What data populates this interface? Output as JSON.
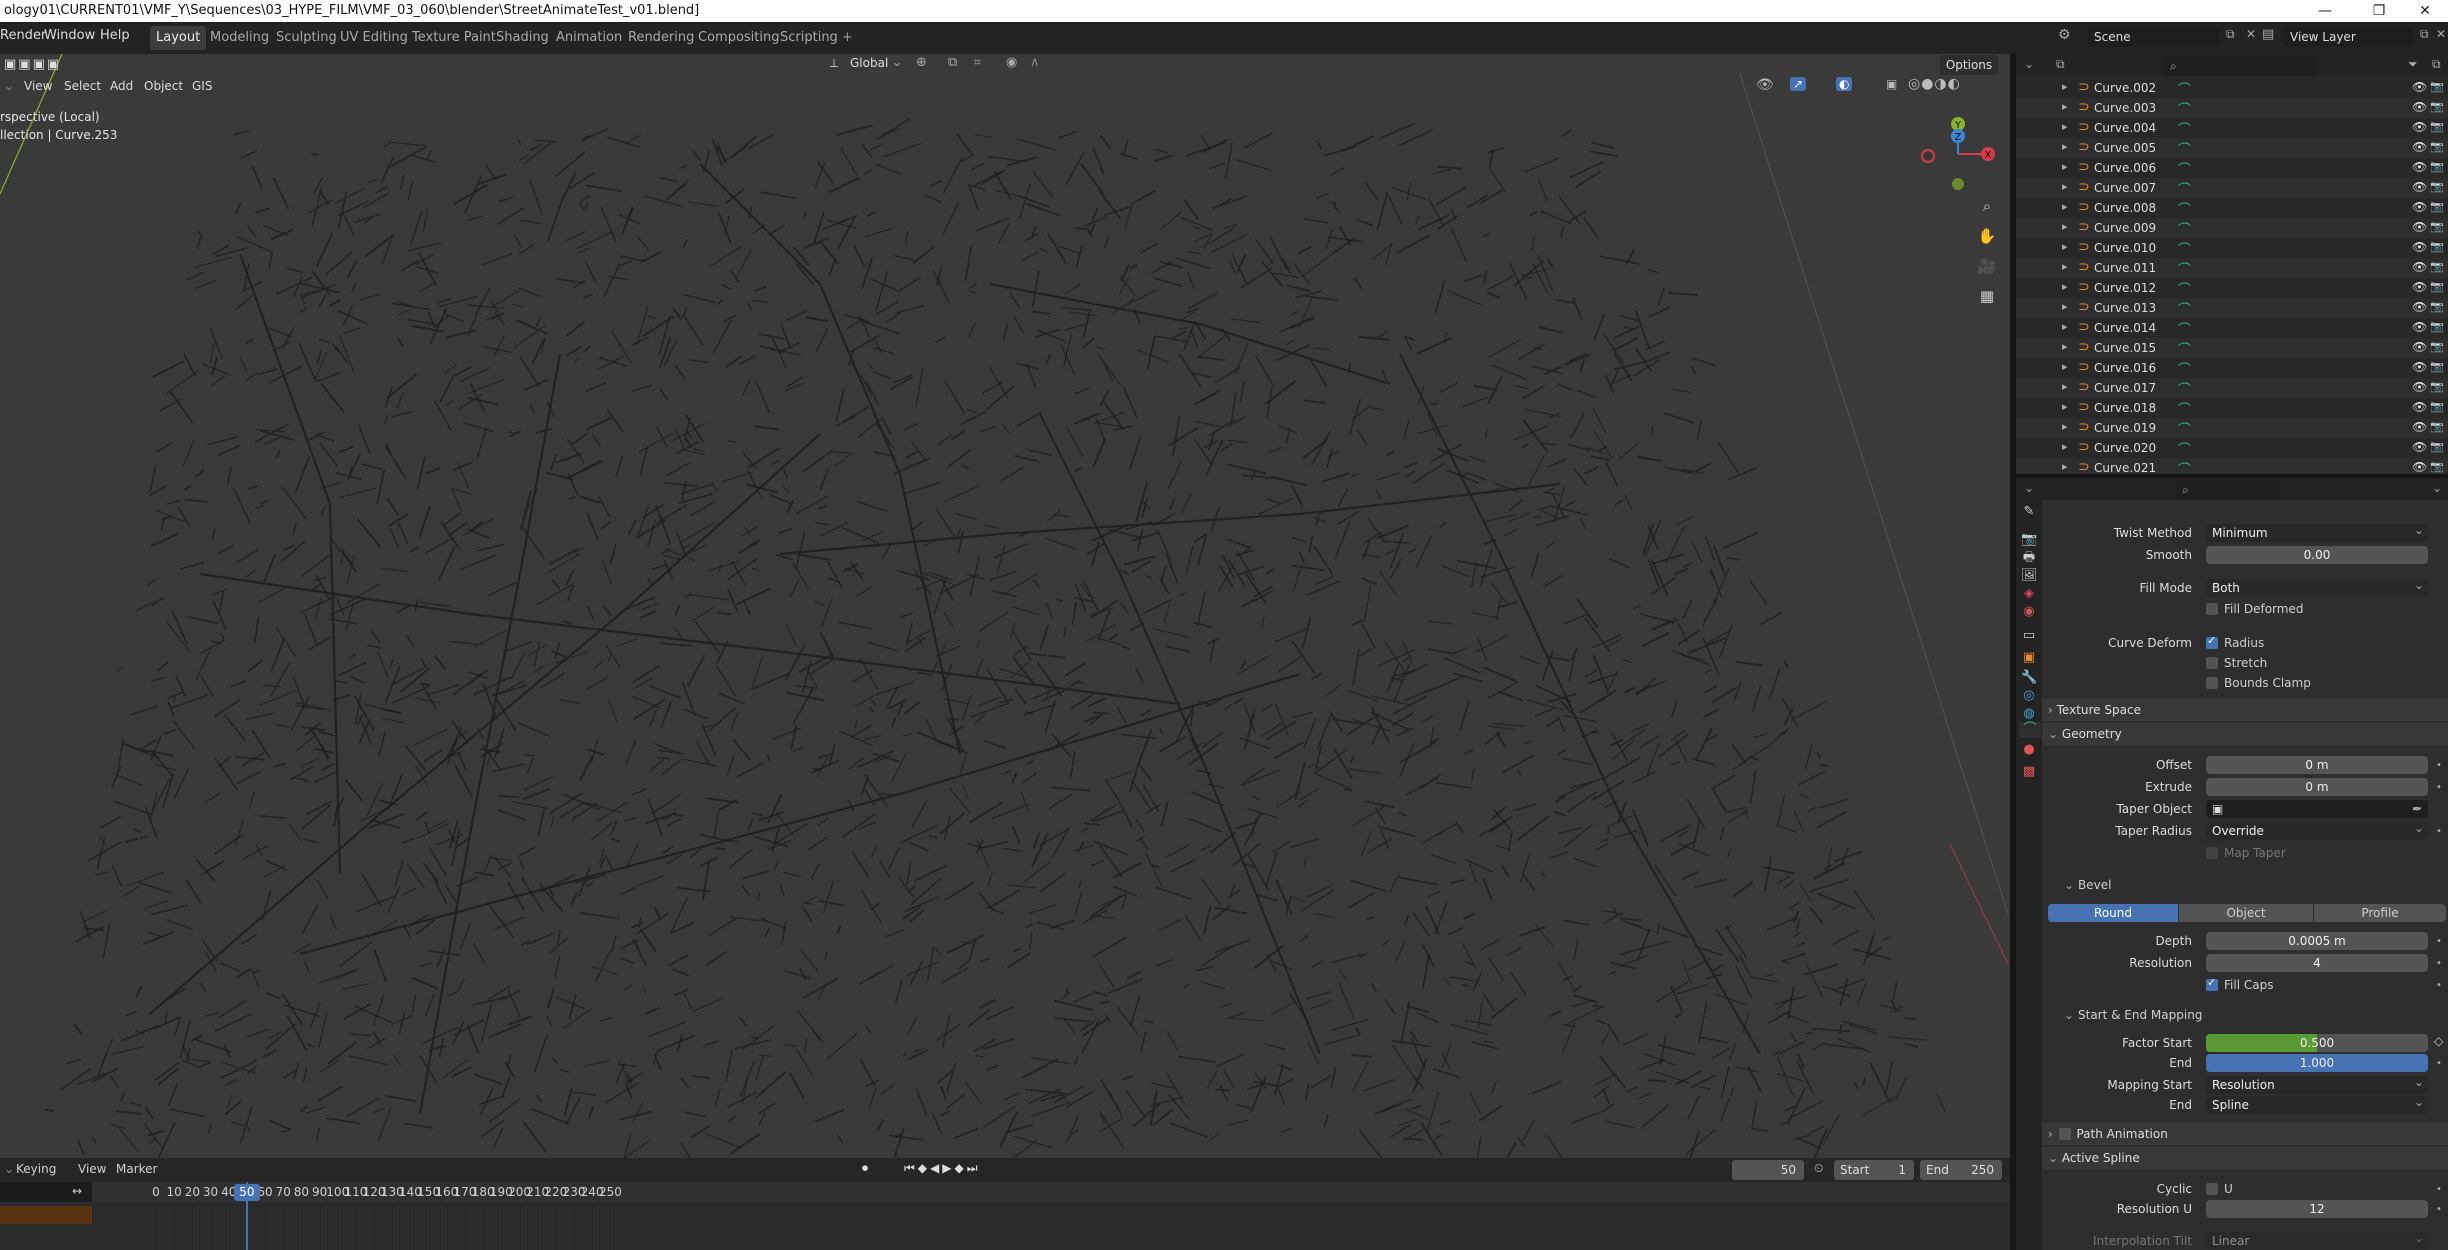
{
  "title_bar": {
    "path": "ology01\\CURRENT01\\VMF_Y\\Sequences\\03_HYPE_FILM\\VMF_03_060\\blender\\StreetAnimateTest_v01.blend]",
    "minimize": "—",
    "maximize": "❐",
    "close": "✕"
  },
  "menu": [
    "Render",
    "Window",
    "Help"
  ],
  "workspaces": [
    "Layout",
    "Modeling",
    "Sculpting",
    "UV Editing",
    "Texture Paint",
    "Shading",
    "Animation",
    "Rendering",
    "Compositing",
    "Scripting"
  ],
  "workspace_add": "+",
  "scene": {
    "label": "Scene",
    "view_layer": "View Layer"
  },
  "viewport": {
    "transform_orientation": "Global",
    "options_label": "Options",
    "menu": [
      "View",
      "Select",
      "Add",
      "Object",
      "GIS"
    ],
    "overlay_line1": "rspective (Local)",
    "overlay_line2": "llection | Curve.253",
    "gizmo": {
      "y": "Y",
      "z": "Z",
      "x": "X"
    },
    "colors": {
      "bg": "#3a3a3a",
      "streets": "#1f1f1f",
      "x_axis": "#d93a4c",
      "y_axis": "#89b32c",
      "z_axis": "#3a86d9"
    }
  },
  "timeline": {
    "menu": [
      "Keying",
      "View",
      "Marker"
    ],
    "current_frame": "50",
    "start_label": "Start",
    "start": "1",
    "end_label": "End",
    "end": "250",
    "ticks": [
      "0",
      "10",
      "20",
      "30",
      "40",
      "50",
      "60",
      "70",
      "80",
      "90",
      "100",
      "110",
      "120",
      "130",
      "140",
      "150",
      "160",
      "170",
      "180",
      "190",
      "200",
      "210",
      "220",
      "230",
      "240",
      "250"
    ],
    "playhead_frame": 50
  },
  "outliner": {
    "items": [
      "Curve.002",
      "Curve.003",
      "Curve.004",
      "Curve.005",
      "Curve.006",
      "Curve.007",
      "Curve.008",
      "Curve.009",
      "Curve.010",
      "Curve.011",
      "Curve.012",
      "Curve.013",
      "Curve.014",
      "Curve.015",
      "Curve.016",
      "Curve.017",
      "Curve.018",
      "Curve.019",
      "Curve.020",
      "Curve.021"
    ]
  },
  "properties": {
    "twist_method": {
      "label": "Twist Method",
      "value": "Minimum"
    },
    "smooth": {
      "label": "Smooth",
      "value": "0.00"
    },
    "fill_mode": {
      "label": "Fill Mode",
      "value": "Both"
    },
    "fill_deformed": "Fill Deformed",
    "curve_deform": {
      "label": "Curve Deform",
      "radius": "Radius",
      "stretch": "Stretch",
      "bounds_clamp": "Bounds Clamp"
    },
    "texture_space": "Texture Space",
    "geometry": "Geometry",
    "offset": {
      "label": "Offset",
      "value": "0 m"
    },
    "extrude": {
      "label": "Extrude",
      "value": "0 m"
    },
    "taper_object": {
      "label": "Taper Object"
    },
    "taper_radius": {
      "label": "Taper Radius",
      "value": "Override"
    },
    "map_taper": "Map Taper",
    "bevel": {
      "label": "Bevel",
      "modes": [
        "Round",
        "Object",
        "Profile"
      ],
      "active": "Round"
    },
    "depth": {
      "label": "Depth",
      "value": "0.0005 m"
    },
    "resolution": {
      "label": "Resolution",
      "value": "4"
    },
    "fill_caps": "Fill Caps",
    "start_end_mapping": "Start & End Mapping",
    "factor_start": {
      "label": "Factor Start",
      "value": "0.500",
      "fraction": 0.5
    },
    "factor_end": {
      "label": "End",
      "value": "1.000",
      "fraction": 1.0
    },
    "mapping_start": {
      "label": "Mapping Start",
      "value": "Resolution"
    },
    "mapping_end": {
      "label": "End",
      "value": "Spline"
    },
    "path_animation": "Path Animation",
    "active_spline": "Active Spline",
    "cyclic": {
      "label": "Cyclic",
      "u": "U"
    },
    "resolution_u": {
      "label": "Resolution U",
      "value": "12"
    },
    "interpolation_tilt": {
      "label": "Interpolation Tilt",
      "value": "Linear"
    },
    "colors": {
      "accent_blue": "#4772b3",
      "accent_green": "#5a9a33"
    }
  }
}
